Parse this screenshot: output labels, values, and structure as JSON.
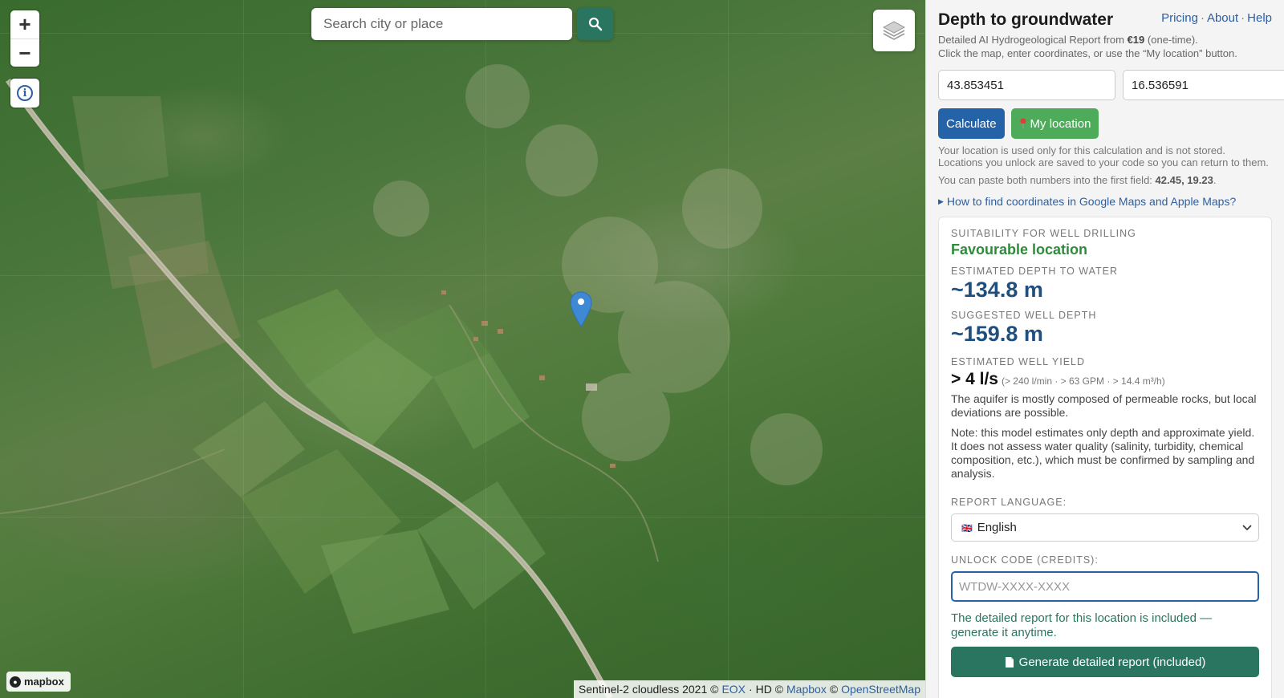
{
  "map": {
    "zoom_in_label": "+",
    "zoom_out_label": "−",
    "info_label": "i",
    "search": {
      "placeholder": "Search city or place",
      "value": ""
    },
    "logo_text": "mapbox",
    "attribution": {
      "prefix": "Sentinel-2 cloudless 2021 ©",
      "eox": "EOX",
      "hd": "· HD ©",
      "mapbox": "Mapbox",
      "osm_sep": "©",
      "osm": "OpenStreetMap"
    }
  },
  "panel": {
    "title": "Depth to groundwater",
    "nav": [
      "Pricing",
      "About",
      "Help"
    ],
    "nav_sep": "·",
    "intro_line1_prefix": "Detailed AI Hydrogeological Report from",
    "intro_price": "€19",
    "intro_line1_suffix": "(one-time).",
    "intro_line2": "Click the map, enter coordinates, or use the “My location” button.",
    "lat": "43.853451",
    "lng": "16.536591",
    "calculate_label": "Calculate",
    "my_location_label": "My location",
    "privacy_note": "Your location is used only for this calculation and is not stored. Locations you unlock are saved to your code so you can return to them.",
    "paste_tip_prefix": "You can paste both numbers into the first field:",
    "paste_tip_example": "42.45, 19.23",
    "paste_tip_suffix": ".",
    "howto_label": "How to find coordinates in Google Maps and Apple Maps?"
  },
  "result": {
    "suitability_caption": "Suitability for well drilling",
    "suitability_value": "Favourable location",
    "depth_caption": "Estimated depth to water",
    "depth_value": "~134.8 m",
    "well_depth_caption": "Suggested well depth",
    "well_depth_value": "~159.8 m",
    "yield_caption": "Estimated well yield",
    "yield_value": "> 4 l/s",
    "yield_detail": "(> 240 l/min · > 63 GPM · > 14.4 m³/h)",
    "aquifer_note": "The aquifer is mostly composed of permeable rocks, but local deviations are possible.",
    "model_note": "Note: this model estimates only depth and approximate yield. It does not assess water quality (salinity, turbidity, chemical composition, etc.), which must be confirmed by sampling and analysis.",
    "language_caption": "Report language:",
    "language_value": "English",
    "unlock_caption": "Unlock code (credits):",
    "unlock_placeholder": "WTDW-XXXX-XXXX",
    "included_text": "The detailed report for this location is included — generate it anytime.",
    "generate_label": "Generate detailed report (included)"
  },
  "colors": {
    "primary_blue": "#2563a9",
    "teal": "#2a7560",
    "green": "#4eab5a",
    "favourable": "#2e8b3c",
    "value_blue": "#1f4f7f",
    "link": "#2b5fa8"
  }
}
